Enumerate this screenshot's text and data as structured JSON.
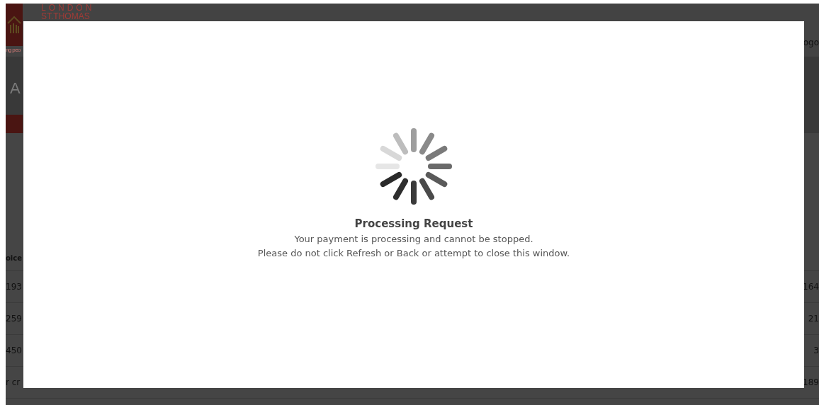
{
  "background_page": {
    "logo": {
      "line_1": "LONDON",
      "line_2": "ST.THOMAS",
      "tagline": "ng peo"
    },
    "header_link": "ogo",
    "heading": "A",
    "table": {
      "header": "oice",
      "rows": [
        {
          "column_1": "193",
          "column_2": "164"
        },
        {
          "column_1": "259",
          "column_2": "21"
        },
        {
          "column_1": "450",
          "column_2": "3"
        },
        {
          "column_1": "r cr",
          "column_2": "189"
        }
      ]
    }
  },
  "dialog": {
    "title": "Processing Request",
    "lines": [
      "Your payment is processing and cannot be stopped.",
      "Please do not click Refresh or Back or attempt to close this window."
    ]
  }
}
